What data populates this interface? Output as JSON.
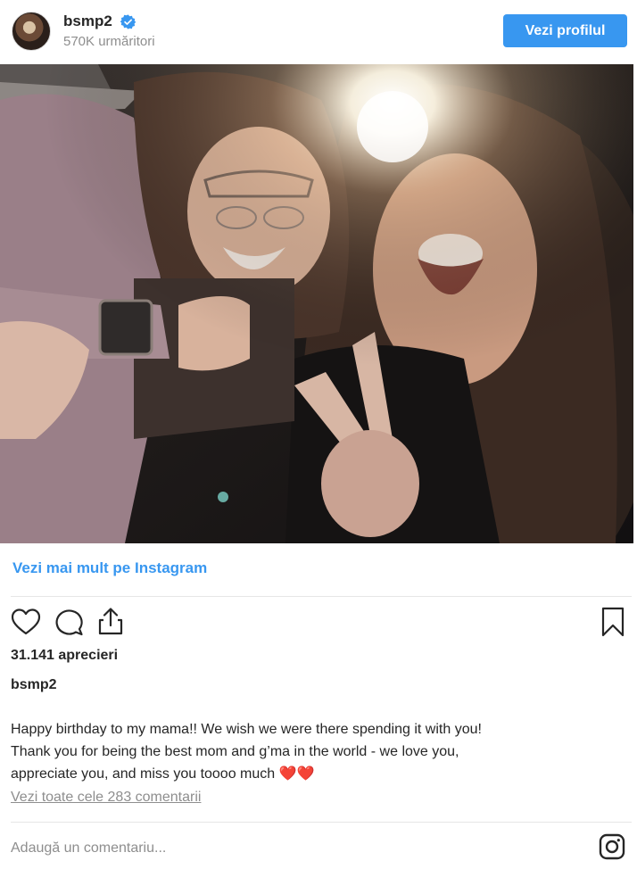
{
  "header": {
    "username": "bsmp2",
    "followers": "570K urmăritori",
    "view_profile_label": "Vezi profilul",
    "verified_icon": "verified-badge-icon"
  },
  "post": {
    "image_icon": "photo",
    "more_link": "Vezi mai mult pe Instagram",
    "likes": "31.141 aprecieri",
    "caption_user": "bsmp2",
    "caption_lines": [
      "Happy birthday to my mama!! We wish we were there spending it with you!",
      "Thank you for being the best mom and g’ma in the world - we love you,",
      "appreciate you, and miss you toooo much ❤️❤️"
    ],
    "view_comments": "Vezi toate cele 283 comentarii",
    "comment_placeholder": "Adaugă un comentariu..."
  },
  "icons": {
    "like": "heart-icon",
    "comment": "comment-bubble-icon",
    "share": "share-icon",
    "save": "bookmark-icon",
    "instagram": "instagram-logo-icon"
  },
  "colors": {
    "accent": "#3897f0",
    "verified": "#3897f0",
    "muted": "#8e8e8e",
    "heart": "#e0245e"
  }
}
